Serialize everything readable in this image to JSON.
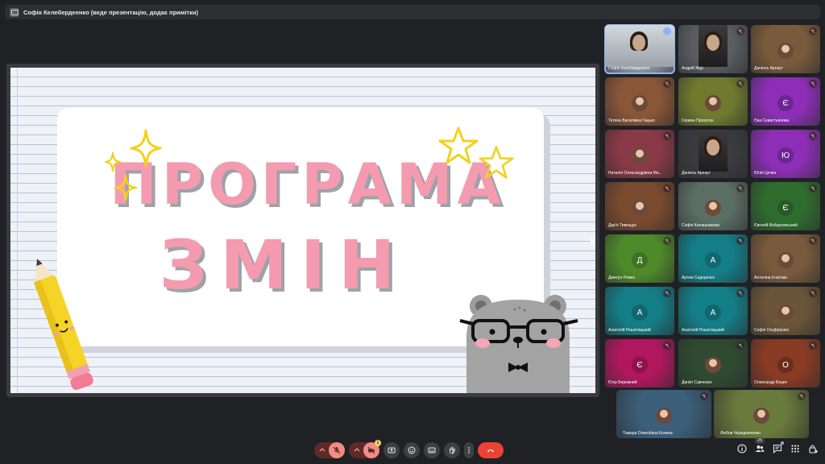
{
  "window": {
    "title": "Софія Келебердеенко (веде презентацію, додає примітки)"
  },
  "slide": {
    "line1": "ПРОГРАМА",
    "line2": "ЗМІН"
  },
  "participants": [
    {
      "name": "Софія Келебердеенко",
      "initial": "",
      "type": "video-active",
      "color": "#9aa3ad"
    },
    {
      "name": "Андрій Жур",
      "initial": "",
      "type": "video",
      "color": "#5b5e60",
      "muted": true
    },
    {
      "name": "Даніель Арнаут",
      "initial": "",
      "type": "photo",
      "color": "#7a5a3c",
      "muted": true
    },
    {
      "name": "Тетяна Василівна Гацько",
      "initial": "",
      "type": "photo",
      "color": "#8a5638",
      "muted": true
    },
    {
      "name": "Герман Прокуган",
      "initial": "",
      "type": "photo",
      "color": "#6f7a2f",
      "muted": true
    },
    {
      "name": "Єва Севастьянова",
      "initial": "Є",
      "type": "letter",
      "color": "#8d2fb6",
      "avatar": "#6c2593",
      "muted": true
    },
    {
      "name": "Наталія Олександрівна Ма...",
      "initial": "",
      "type": "photo",
      "color": "#8a3a46",
      "muted": true
    },
    {
      "name": "Даніель Арнаут",
      "initial": "",
      "type": "video",
      "color": "#3a3b3e",
      "muted": false
    },
    {
      "name": "Юлія Цочка",
      "initial": "Ю",
      "type": "letter",
      "color": "#8d2fb6",
      "avatar": "#6c2593",
      "muted": true
    },
    {
      "name": "Дар'я Тимощук",
      "initial": "",
      "type": "photo",
      "color": "#7a4a2e",
      "muted": true
    },
    {
      "name": "Софія Калашникова",
      "initial": "",
      "type": "photo",
      "color": "#5b6e64",
      "muted": true
    },
    {
      "name": "Євгеній Войцеховський",
      "initial": "Є",
      "type": "letter",
      "color": "#2f6d2f",
      "avatar": "#275a27",
      "muted": true
    },
    {
      "name": "Дмитро Ряжко",
      "initial": "Д",
      "type": "letter",
      "color": "#4f8a2a",
      "avatar": "#3f7122",
      "muted": true
    },
    {
      "name": "Артем Сидоренко",
      "initial": "А",
      "type": "letter",
      "color": "#147e87",
      "avatar": "#0f6870",
      "muted": true
    },
    {
      "name": "Антоніна Ігнатова",
      "initial": "",
      "type": "photo",
      "color": "#7a5a3c",
      "muted": true
    },
    {
      "name": "Анатолій Решетицький",
      "initial": "А",
      "type": "letter",
      "color": "#147e87",
      "avatar": "#0f6870",
      "muted": true
    },
    {
      "name": "Анатолій Решетицький",
      "initial": "А",
      "type": "letter",
      "color": "#147e87",
      "avatar": "#0f6870",
      "muted": true
    },
    {
      "name": "Софія Онуфрієнко",
      "initial": "",
      "type": "photo",
      "color": "#6b5538",
      "muted": true
    },
    {
      "name": "Єгор Бережний",
      "initial": "Є",
      "type": "letter",
      "color": "#b0175e",
      "avatar": "#8e124b",
      "muted": true
    },
    {
      "name": "Данііл Савченко",
      "initial": "",
      "type": "photo",
      "color": "#2f4a30",
      "muted": true
    },
    {
      "name": "Олександр Бицек",
      "initial": "О",
      "type": "letter",
      "color": "#8a3b24",
      "avatar": "#6b2d1b",
      "muted": true
    },
    {
      "name": "Тамара Олексіївна Кочина",
      "initial": "",
      "type": "photo",
      "color": "#3c5f7a",
      "muted": true
    },
    {
      "name": "Любов Чередниченко",
      "initial": "",
      "type": "photo",
      "color": "#6a7a3c",
      "muted": true
    }
  ],
  "controls": {
    "camera_badge": "1",
    "participant_count": "25"
  },
  "colors": {
    "background": "#202124",
    "pink": "#f49bb0",
    "end_call": "#ea4335",
    "active_outline": "#8ab4f8"
  }
}
